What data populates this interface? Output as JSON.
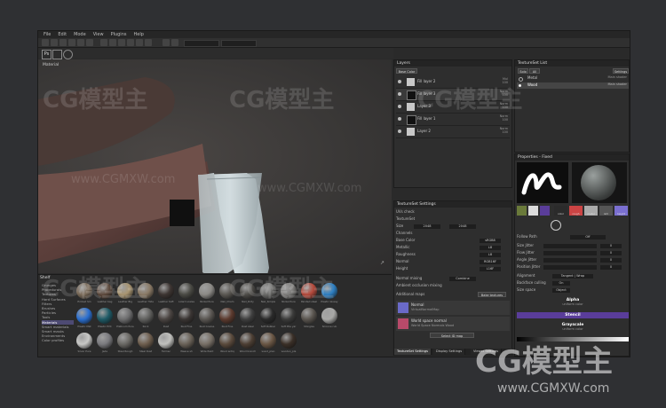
{
  "menu": [
    "File",
    "Edit",
    "Mode",
    "View",
    "Plugins",
    "Help"
  ],
  "viewport": {
    "label": "Material"
  },
  "layers": {
    "title": "Layers",
    "blend_mode": "Base Color",
    "rows": [
      {
        "name": "Fill layer 2",
        "vals": [
          "Mul",
          "100"
        ]
      },
      {
        "name": "Fill layer 3",
        "vals": [
          "Norm",
          "100"
        ]
      },
      {
        "name": "Layer 3",
        "vals": [
          "Norm",
          "100"
        ]
      },
      {
        "name": "Fill layer 1",
        "vals": [
          "Norm",
          "100"
        ]
      },
      {
        "name": "Layer 2",
        "vals": [
          "Norm",
          "100"
        ]
      }
    ]
  },
  "textureset_list": {
    "title": "TextureSet List",
    "tabs": [
      "Solo",
      "All"
    ],
    "settings": "Settings",
    "items": [
      {
        "name": "Metal",
        "shader": "Main shader"
      },
      {
        "name": "Wood",
        "shader": "Main shader"
      }
    ]
  },
  "textureset_settings": {
    "title": "TextureSet Settings",
    "uv_label": "UVs check",
    "textureset": "TextureSet",
    "size_label": "Size",
    "size_value": "2048",
    "channels_label": "Channels",
    "channels": [
      {
        "name": "Base Color",
        "val": "sRGB8"
      },
      {
        "name": "Metallic",
        "val": "L8"
      },
      {
        "name": "Roughness",
        "val": "L8"
      },
      {
        "name": "Normal",
        "val": "RGB16F"
      },
      {
        "name": "Height",
        "val": "L16F"
      }
    ],
    "normal_mix": "Normal mixing",
    "normal_mix_value": "Combine",
    "ao_mix": "Ambient occlusion mixing",
    "additional_maps": "Additional maps",
    "bake_button": "Bake textures",
    "maps": [
      {
        "name": "Normal",
        "sub": "VirtualNormalMap"
      },
      {
        "name": "World space normal",
        "sub": "World Space Normals Wood"
      }
    ],
    "select_map": "Select ID map"
  },
  "properties": {
    "title": "Properties - Fixed",
    "channels": [
      "color",
      "rough",
      "metal",
      "nrm",
      "height"
    ],
    "fill_label": "Follow Path",
    "fill_value": "Off",
    "rows": [
      {
        "name": "Size Jitter",
        "val": "0"
      },
      {
        "name": "Flow Jitter",
        "val": "0"
      },
      {
        "name": "Angle Jitter",
        "val": "0"
      },
      {
        "name": "Position Jitter",
        "val": "0"
      }
    ],
    "alignment_label": "Alignment",
    "alignment_value": "Tangent | Wrap",
    "backface_label": "Backface culling",
    "backface_value": "On",
    "size_space_label": "Size space",
    "size_space_value": "Object",
    "alpha_title": "Alpha",
    "alpha_sub": "uniform color",
    "stencil_title": "Stencil",
    "grayscale_title": "Grayscale",
    "grayscale_sub": "uniform color"
  },
  "shelf": {
    "title": "Shelf",
    "categories": [
      "Grunges",
      "Procedurals",
      "Textures",
      "Hard Surfaces",
      "Filters",
      "Brushes",
      "Particles",
      "Tools",
      "Materials",
      "Smart materials",
      "Smart masks",
      "Environments",
      "Color profiles"
    ],
    "selected": "Materials",
    "materials": [
      {
        "label": "Embed Sm",
        "color": "#7a6a58"
      },
      {
        "label": "Leather bag",
        "color": "#5e4a3d"
      },
      {
        "label": "Leather Big",
        "color": "#a89470"
      },
      {
        "label": "Leather Hide",
        "color": "#8a7a66"
      },
      {
        "label": "Leather Soft",
        "color": "#3d3532"
      },
      {
        "label": "Lizard scales",
        "color": "#4a4a44"
      },
      {
        "label": "Nickel Pure",
        "color": "#8c8a86"
      },
      {
        "label": "Nail_Cham",
        "color": "#5b5853"
      },
      {
        "label": "Nail_Dirty",
        "color": "#4e4c48"
      },
      {
        "label": "Nail_Simple",
        "color": "#6a6a68"
      },
      {
        "label": "Nickel Pure",
        "color": "#7e7d7b"
      },
      {
        "label": "Painted steel",
        "color": "#b54a3c"
      },
      {
        "label": "Plastic Glossy",
        "color": "#2d7fc2"
      },
      {
        "label": "Plastic Mat",
        "color": "#2a6fd0"
      },
      {
        "label": "Plastic PVC",
        "color": "#1e5a66"
      },
      {
        "label": "Platinum Pure",
        "color": "#6d6d6e"
      },
      {
        "label": "Rock",
        "color": "#60605e"
      },
      {
        "label": "Rust",
        "color": "#4a4441"
      },
      {
        "label": "Rust Fine",
        "color": "#3a3533"
      },
      {
        "label": "Rust Coarse",
        "color": "#5a5652"
      },
      {
        "label": "Rust Fine",
        "color": "#5c3a2e"
      },
      {
        "label": "Rust steel",
        "color": "#3e3e3e"
      },
      {
        "label": "Soft Rubber",
        "color": "#2a2a2a"
      },
      {
        "label": "Soft Pile yar",
        "color": "#3b3b3a"
      },
      {
        "label": "Shingles",
        "color": "#5a554f"
      },
      {
        "label": "Silicone rub",
        "color": "#a8a8a6"
      },
      {
        "label": "Silver Pure",
        "color": "#c8c8c6"
      },
      {
        "label": "Jade",
        "color": "#7a7a7e"
      },
      {
        "label": "Steel Rough",
        "color": "#6a6864"
      },
      {
        "label": "Steel Rust",
        "color": "#6e5e4e"
      },
      {
        "label": "Tarmac",
        "color": "#c0c0bd"
      },
      {
        "label": "Weave sh",
        "color": "#6a6258"
      },
      {
        "label": "Wide Paint",
        "color": "#776f66"
      },
      {
        "label": "Wood antiq",
        "color": "#5a4a3c"
      },
      {
        "label": "Wood branch",
        "color": "#4c3e33"
      },
      {
        "label": "wood_plan",
        "color": "#6a5644"
      },
      {
        "label": "wooden_pla",
        "color": "#3a2f27"
      }
    ]
  },
  "bottom_tabs": [
    "TextureSet Settings",
    "Display Settings",
    "Viewer Settings"
  ],
  "watermark": {
    "logo": "CG模型主",
    "url": "www.CGMXW.com"
  },
  "colors": {
    "accent": "#4d4a73",
    "stencil": "#5a3d9a"
  }
}
